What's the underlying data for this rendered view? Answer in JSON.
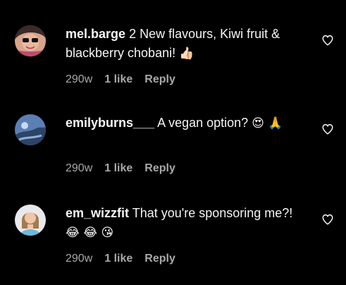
{
  "comments": [
    {
      "username": "mel.barge",
      "text": "2 New flavours, Kiwi fruit & blackberry chobani!",
      "emojis": "👍🏻",
      "time": "290w",
      "likes": "1 like",
      "reply": "Reply"
    },
    {
      "username": "emilyburns___",
      "text": "A vegan option?",
      "emojis": "😍 🙏",
      "time": "290w",
      "likes": "1 like",
      "reply": "Reply"
    },
    {
      "username": "em_wizzfit",
      "text": "That you're sponsoring me?!",
      "emojis": "😂 😂 😘",
      "time": "290w",
      "likes": "1 like",
      "reply": "Reply"
    }
  ],
  "icons": {
    "like": "heart-outline-icon"
  },
  "colors": {
    "background": "#000000",
    "primary_text": "#f5f5f5",
    "secondary_text": "#a8a8a8"
  }
}
